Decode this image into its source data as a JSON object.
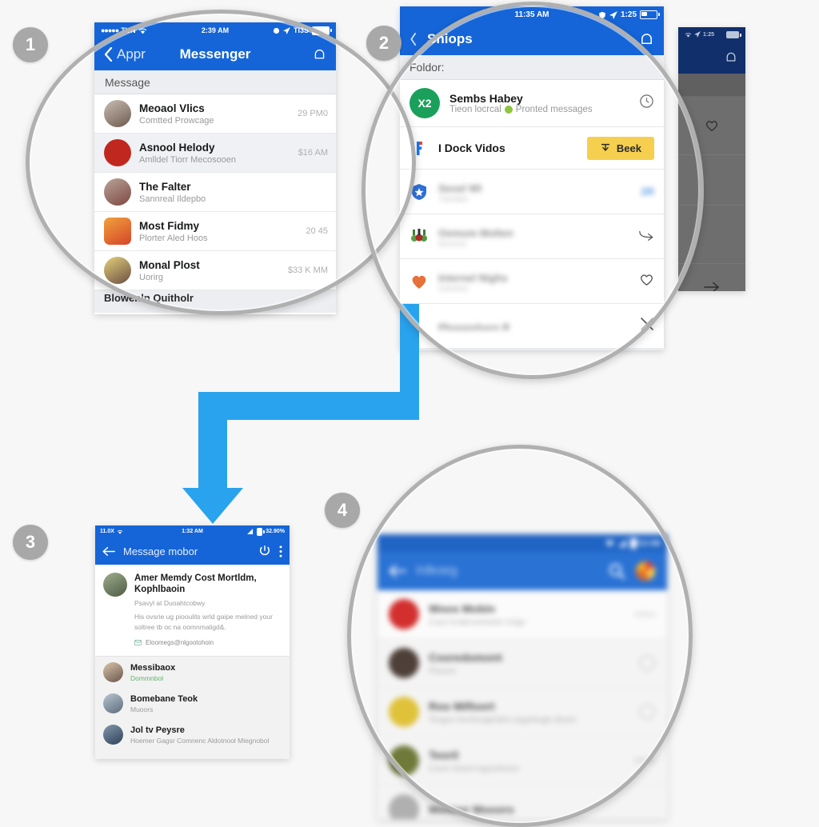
{
  "steps": [
    {
      "number": "1"
    },
    {
      "number": "2"
    },
    {
      "number": "3"
    },
    {
      "number": "4"
    }
  ],
  "panel1": {
    "status": {
      "carrier": "TUN",
      "dots": "●●●●●",
      "time": "2:39 AM",
      "right": "TI3S",
      "wifi_icon": "wifi-icon",
      "battery_icon": "battery-icon"
    },
    "nav": {
      "back_icon": "chevron-left-icon",
      "back_label": "Appr",
      "title": "Messenger",
      "right_icon": "bell-icon"
    },
    "section_header": "Message",
    "rows": [
      {
        "name": "Meoaol Vlics",
        "sub": "Comtted Prowcage",
        "time": "29 PM0",
        "avatar_color": "#b9a79c"
      },
      {
        "name": "Asnool Helody",
        "sub": "Amlldel Tiorr Mecosooen",
        "time": "$16 AM",
        "avatar_color": "#c0281f"
      },
      {
        "name": "The Falter",
        "sub": "Sannreal Ildepbo",
        "time": "",
        "avatar_color": "#a28d84"
      },
      {
        "name": "Most Fidmy",
        "sub": "Plorter Aled Hoos",
        "time": "20 45",
        "avatar_color": "#e2653a"
      },
      {
        "name": "Monal Plost",
        "sub": "Uorirg",
        "time": "$33 K MM",
        "avatar_color": "#9f8678"
      }
    ],
    "cutoff_row": "Blowenln Quitholr"
  },
  "panel2_back": {
    "status": {
      "right": "1:25"
    },
    "nav": {
      "right_icon": "bell-icon"
    },
    "rows": [
      {
        "icon": "heart-icon"
      },
      {
        "icon": ""
      },
      {
        "icon": "arrow-right-icon"
      }
    ]
  },
  "panel2": {
    "status": {
      "time": "11:35 AM",
      "right": "1:25",
      "shield_icon": "shield-icon",
      "send_icon": "send-icon",
      "battery_icon": "battery-icon"
    },
    "nav": {
      "back_icon": "chevron-left-icon",
      "title": "Shiops",
      "right_icon": "bell-icon"
    },
    "section_header": "Foldor:",
    "row1": {
      "badge": "X2",
      "name": "Sembs Habey",
      "sub_pre": "Tieon locrcal",
      "sub_post": "Pronted messages",
      "end_icon": "clock-icon"
    },
    "row2": {
      "icon": "facebook-icon",
      "name": "I Dock Vidos",
      "button_label": "Beek",
      "button_icon": "download-icon",
      "button_color": "#f6cf4f"
    },
    "blurred_rows": [
      {
        "name": "Seoel WI",
        "sub": "Tiahdaly",
        "end_label": "2R",
        "icon_color": "#2e6fd8",
        "icon": "shield-star-icon"
      },
      {
        "name": "Oemom Molten",
        "sub": "MonGol",
        "end_label": "",
        "icon_color": "#5aa04a",
        "icon": "people-icon",
        "end_icon": "arrow-curve-icon"
      },
      {
        "name": "Internel Nighs",
        "sub": "Gotofoin",
        "end_label": "",
        "icon_color": "#e8703a",
        "icon": "heart-shape-icon",
        "end_icon": "heart-icon"
      },
      {
        "name": "Phoogshorn R",
        "sub": "",
        "end_label": "",
        "icon_color": "#bdbdbd",
        "icon": "",
        "end_icon": "close-icon"
      }
    ]
  },
  "panel3": {
    "status": {
      "carrier": "11.0X",
      "time": "1:32 AM",
      "right": "32.90%",
      "wifi_icon": "wifi-icon",
      "battery_icon": "battery-icon"
    },
    "nav": {
      "back_icon": "arrow-left-icon",
      "title": "Message mobor",
      "refresh_icon": "refresh-icon",
      "menu_icon": "overflow-menu-icon"
    },
    "card": {
      "name": "Amer Memdy Cost Mortldm, Kophlbaoin",
      "sub": "Psavyl at Duoahtcobwy",
      "body": "His ovsrie ug piooulits wrld gaipe melned your soltree tb oc na oomnmaligd&.",
      "mail": "Eloomegs@nlgootohoin",
      "mail_icon": "mail-icon",
      "avatar_color": "#7e8f6e"
    },
    "rows": [
      {
        "name": "Messibaox",
        "sub": "Dommnbol",
        "sub_color": "#63b36b",
        "avatar_color": "#b7a390"
      },
      {
        "name": "Bomebane Teok",
        "sub": "Muoors",
        "sub_color": "#9b9b9b",
        "avatar_color": "#97a7b5"
      },
      {
        "name": "Jol tv Peysre",
        "sub": "Hoemer Gagsr Comnenc Aldotnool Miegnobol",
        "sub_color": "#9b9b9b",
        "avatar_color": "#5b6f86"
      }
    ]
  },
  "panel4": {
    "status": {
      "time": "12 AM",
      "wifi_icon": "wifi-icon",
      "signal_icon": "signal-icon",
      "battery_icon": "battery-icon"
    },
    "nav": {
      "back_icon": "arrow-left-icon",
      "title": "Inlkoeg",
      "search_icon": "search-icon",
      "avatar_icon": "account-avatar-icon"
    },
    "rows": [
      {
        "name": "Woos Mobin",
        "sub": "Coon lcnderreemetor nnigo",
        "time": "103mn",
        "avatar_color": "#d32f2f"
      },
      {
        "name": "Cooredomont",
        "sub": "Ptooonr",
        "time": "",
        "avatar_color": "#4e4039",
        "end_icon": "circle-icon"
      },
      {
        "name": "Roo Mifloort",
        "sub": "Tougos lrecrhnogindols segarlmglo dloom",
        "time": "",
        "avatar_color": "#e0c23a",
        "end_icon": "circle-icon"
      },
      {
        "name": "Teoril",
        "sub": "Coom Hoool Iogesolmoor",
        "time": "1800m",
        "avatar_color": "#6f7a3a"
      },
      {
        "name": "Monoor Moooro",
        "sub": "",
        "time": "",
        "avatar_color": "#b0b0b0"
      }
    ]
  },
  "colors": {
    "brand_blue": "#1565d8",
    "arrow_blue": "#29a3ee",
    "ring_gray": "#b0b0b0",
    "badge_gray": "#a8a8a8",
    "accent_yellow": "#f6cf4f",
    "accent_green": "#1aa05a"
  }
}
